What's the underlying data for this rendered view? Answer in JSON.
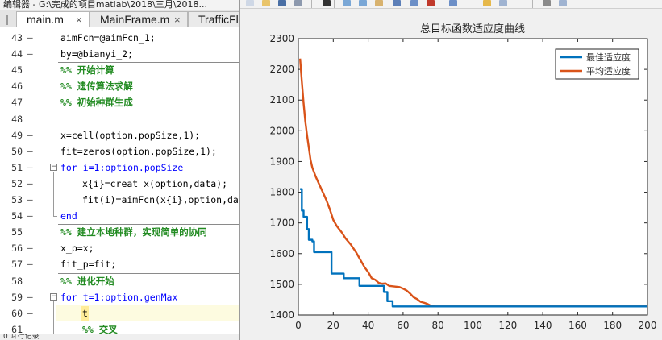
{
  "editor": {
    "title": "编辑器 - G:\\完成的项目matlab\\2018\\三月\\2018...",
    "tabs": [
      {
        "label": "main.m",
        "close": "×"
      },
      {
        "label": "MainFrame.m",
        "close": "×"
      },
      {
        "label": "TrafficFl"
      }
    ],
    "statusbar": "0 ㄐ行记录",
    "lines": [
      {
        "num": "43",
        "mark": "—",
        "text": "aimFcn=@aimFcn_1;",
        "kind": "code",
        "indent": 0
      },
      {
        "num": "44",
        "mark": "—",
        "text": "by=@bianyi_2;",
        "kind": "code",
        "indent": 0
      },
      {
        "num": "45",
        "mark": "",
        "text": "%% 开始计算",
        "kind": "comment",
        "indent": 0
      },
      {
        "num": "46",
        "mark": "",
        "text": "%% 遗传算法求解",
        "kind": "comment",
        "indent": 0
      },
      {
        "num": "47",
        "mark": "",
        "text": "%% 初始种群生成",
        "kind": "comment",
        "indent": 0
      },
      {
        "num": "48",
        "mark": "",
        "text": "",
        "kind": "code",
        "indent": 0
      },
      {
        "num": "49",
        "mark": "—",
        "text": "x=cell(option.popSize,1);",
        "kind": "code",
        "indent": 0
      },
      {
        "num": "50",
        "mark": "—",
        "text": "fit=zeros(option.popSize,1);",
        "kind": "code",
        "indent": 0
      },
      {
        "num": "51",
        "mark": "—",
        "text": "for i=1:option.popSize",
        "kind": "keyword",
        "indent": 0
      },
      {
        "num": "52",
        "mark": "—",
        "text": "x{i}=creat_x(option,data);",
        "kind": "code",
        "indent": 1
      },
      {
        "num": "53",
        "mark": "—",
        "text": "fit(i)=aimFcn(x{i},option,da",
        "kind": "code",
        "indent": 1
      },
      {
        "num": "54",
        "mark": "—",
        "text": "end",
        "kind": "keyword",
        "indent": 0
      },
      {
        "num": "55",
        "mark": "",
        "text": "%% 建立本地种群，实现简单的协同",
        "kind": "comment",
        "indent": 0
      },
      {
        "num": "56",
        "mark": "—",
        "text": "x_p=x;",
        "kind": "code",
        "indent": 0
      },
      {
        "num": "57",
        "mark": "—",
        "text": "fit_p=fit;",
        "kind": "code",
        "indent": 0
      },
      {
        "num": "58",
        "mark": "",
        "text": "%% 进化开始",
        "kind": "comment",
        "indent": 0
      },
      {
        "num": "59",
        "mark": "—",
        "text": "for t=1:option.genMax",
        "kind": "keyword",
        "indent": 0
      },
      {
        "num": "60",
        "mark": "—",
        "text": "t",
        "kind": "code",
        "indent": 1
      },
      {
        "num": "61",
        "mark": "",
        "text": "%% 交叉",
        "kind": "comment",
        "indent": 1
      }
    ]
  },
  "figure": {
    "toolbar_icons": [
      "new-figure-icon",
      "open-file-icon",
      "save-icon",
      "print-icon",
      "pointer-icon",
      "zoom-in-icon",
      "zoom-out-icon",
      "pan-icon",
      "rotate-icon",
      "data-cursor-icon",
      "brush-icon",
      "link-icon",
      "colorbar-icon",
      "legend-icon",
      "hide-plot-tools-icon",
      "show-plot-tools-icon"
    ]
  },
  "chart_data": {
    "type": "line",
    "title": "总目标函数适应度曲线",
    "xlabel": "",
    "ylabel": "",
    "xlim": [
      0,
      200
    ],
    "ylim": [
      1400,
      2300
    ],
    "xticks": [
      0,
      20,
      40,
      60,
      80,
      100,
      120,
      140,
      160,
      180,
      200
    ],
    "yticks": [
      1400,
      1500,
      1600,
      1700,
      1800,
      1900,
      2000,
      2100,
      2200,
      2300
    ],
    "grid": false,
    "legend_position": "top-right",
    "series": [
      {
        "name": "最佳适应度",
        "color": "#0072bd",
        "step": true,
        "points": [
          [
            1,
            1810
          ],
          [
            2,
            1740
          ],
          [
            3,
            1720
          ],
          [
            5,
            1680
          ],
          [
            6,
            1645
          ],
          [
            8,
            1640
          ],
          [
            9,
            1605
          ],
          [
            18,
            1605
          ],
          [
            19,
            1535
          ],
          [
            25,
            1535
          ],
          [
            26,
            1520
          ],
          [
            34,
            1520
          ],
          [
            35,
            1495
          ],
          [
            48,
            1495
          ],
          [
            49,
            1475
          ],
          [
            50,
            1475
          ],
          [
            51,
            1445
          ],
          [
            53,
            1445
          ],
          [
            54,
            1428
          ],
          [
            70,
            1428
          ],
          [
            75,
            1428
          ],
          [
            200,
            1428
          ]
        ]
      },
      {
        "name": "平均适应度",
        "color": "#d95319",
        "step": false,
        "points": [
          [
            1,
            2235
          ],
          [
            2,
            2160
          ],
          [
            3,
            2090
          ],
          [
            4,
            2030
          ],
          [
            5,
            1985
          ],
          [
            6,
            1945
          ],
          [
            7,
            1905
          ],
          [
            8,
            1880
          ],
          [
            10,
            1850
          ],
          [
            12,
            1825
          ],
          [
            14,
            1800
          ],
          [
            16,
            1775
          ],
          [
            18,
            1745
          ],
          [
            20,
            1710
          ],
          [
            22,
            1690
          ],
          [
            25,
            1668
          ],
          [
            27,
            1650
          ],
          [
            30,
            1630
          ],
          [
            33,
            1605
          ],
          [
            35,
            1585
          ],
          [
            38,
            1555
          ],
          [
            40,
            1540
          ],
          [
            42,
            1520
          ],
          [
            44,
            1515
          ],
          [
            46,
            1505
          ],
          [
            48,
            1502
          ],
          [
            50,
            1503
          ],
          [
            52,
            1495
          ],
          [
            55,
            1493
          ],
          [
            58,
            1491
          ],
          [
            60,
            1486
          ],
          [
            62,
            1480
          ],
          [
            64,
            1470
          ],
          [
            66,
            1458
          ],
          [
            68,
            1452
          ],
          [
            70,
            1443
          ],
          [
            72,
            1440
          ],
          [
            74,
            1436
          ],
          [
            76,
            1430
          ],
          [
            78,
            1428
          ],
          [
            200,
            1428
          ]
        ]
      }
    ]
  }
}
